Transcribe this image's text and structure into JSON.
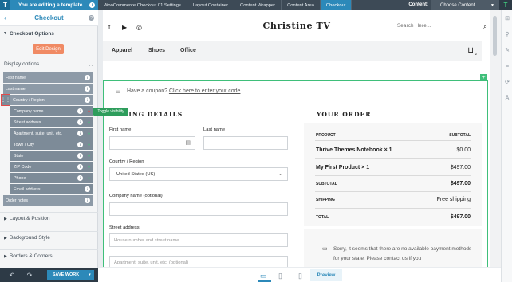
{
  "template_banner": {
    "logo": "T",
    "text": "You are editing a template",
    "info": "i"
  },
  "panel": {
    "title": "Checkout",
    "back": "‹",
    "help": "?"
  },
  "checkout_options": {
    "label": "Checkout Options",
    "edit_button": "Edit Design"
  },
  "display_options": {
    "label": "Display options",
    "fields": [
      {
        "label": "First name",
        "level": 0
      },
      {
        "label": "Last name",
        "level": 0
      },
      {
        "label": "Country / Region",
        "level": 0,
        "selected": true
      },
      {
        "label": "Company name",
        "level": 1,
        "visible": false
      },
      {
        "label": "Street address",
        "level": 1,
        "visible": true
      },
      {
        "label": "Apartment, suite, unit, etc.",
        "level": 1,
        "visible": true
      },
      {
        "label": "Town / City",
        "level": 1,
        "visible": true
      },
      {
        "label": "State",
        "level": 1,
        "visible": true
      },
      {
        "label": "ZIP Code",
        "level": 1,
        "visible": true
      },
      {
        "label": "Phone",
        "level": 1,
        "visible": true
      },
      {
        "label": "Email address",
        "level": 1,
        "visible": false
      },
      {
        "label": "Order notes",
        "level": 0
      }
    ]
  },
  "tooltip": "Toggle visibility",
  "accordions": [
    "Layout & Position",
    "Background Style",
    "Borders & Corners"
  ],
  "footer": {
    "save_label": "SAVE WORK",
    "more": "▾"
  },
  "breadcrumbs": [
    "WooCommerce Checkout 01 Settings",
    "Layout Container",
    "Content Wrapper",
    "Content Area",
    "Checkout"
  ],
  "content_selector": {
    "label": "Content:",
    "value": "Choose Content"
  },
  "site": {
    "title": "Christine TV",
    "search_placeholder": "Search Here...",
    "nav": [
      "Apparel",
      "Shoes",
      "Office"
    ],
    "cart_count": "2"
  },
  "coupon": {
    "text": "Have a coupon?",
    "link": "Click here to enter your code"
  },
  "billing": {
    "title": "BILLING DETAILS",
    "first_name_label": "First name",
    "last_name_label": "Last name",
    "country_label": "Country / Region",
    "country_value": "United States (US)",
    "company_label": "Company name (optional)",
    "street_label": "Street address",
    "street_placeholder": "House number and street name",
    "apt_placeholder": "Apartment, suite, unit, etc. (optional)"
  },
  "order": {
    "title": "YOUR ORDER",
    "col_product": "PRODUCT",
    "col_subtotal": "SUBTOTAL",
    "items": [
      {
        "name": "Thrive Themes Notebook  × 1",
        "price": "$0.00"
      },
      {
        "name": "My First Product  × 1",
        "price": "$497.00"
      }
    ],
    "subtotal_label": "SUBTOTAL",
    "subtotal_value": "$497.00",
    "shipping_label": "SHIPPING",
    "shipping_value": "Free shipping",
    "total_label": "TOTAL",
    "total_value": "$497.00"
  },
  "payment_notice": "Sorry, it seems that there are no available payment methods for your state. Please contact us if you",
  "preview_label": "Preview",
  "colors": {
    "brand_blue": "#2c89b9",
    "accent_green": "#3fbf7a",
    "edit_orange": "#f08a64",
    "field_gray": "#8d9aa7"
  }
}
